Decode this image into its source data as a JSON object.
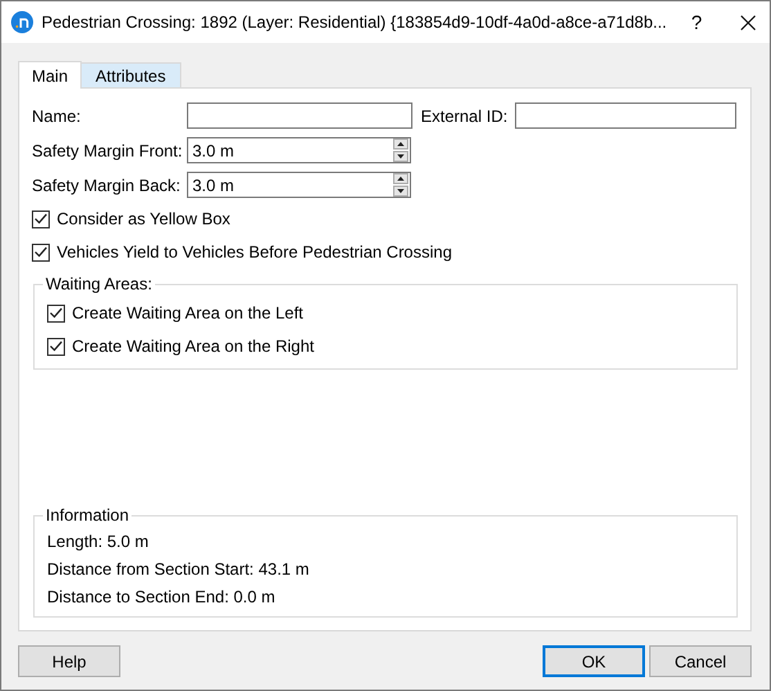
{
  "window": {
    "title": "Pedestrian Crossing: 1892 (Layer: Residential) {183854d9-10df-4a0d-a8ce-a71d8b...",
    "help_glyph": "?"
  },
  "tabs": [
    {
      "label": "Main",
      "selected": true
    },
    {
      "label": "Attributes",
      "selected": false
    }
  ],
  "name_row": {
    "name_label": "Name:",
    "external_id_label": "External ID:"
  },
  "spin_fields": [
    {
      "label": "Safety Margin Front:",
      "value": "3.0 m"
    },
    {
      "label": "Safety Margin Back:",
      "value": "3.0 m"
    }
  ],
  "checkboxes": [
    {
      "label": "Consider as Yellow Box",
      "checked": true
    },
    {
      "label": "Vehicles Yield to Vehicles Before Pedestrian Crossing",
      "checked": true
    }
  ],
  "waiting_areas": {
    "title": "Waiting Areas:",
    "options": [
      {
        "label": "Create Waiting Area on the Left",
        "checked": true
      },
      {
        "label": "Create Waiting Area on the Right",
        "checked": true
      }
    ]
  },
  "information": {
    "title": "Information",
    "lines": [
      "Length: 5.0 m",
      "Distance from Section Start: 43.1 m",
      "Distance to Section End: 0.0 m"
    ]
  },
  "left_buttons": [
    {
      "label": "Help",
      "default": false
    }
  ],
  "right_buttons": [
    {
      "label": "OK",
      "default": true
    },
    {
      "label": "Cancel",
      "default": false
    }
  ]
}
